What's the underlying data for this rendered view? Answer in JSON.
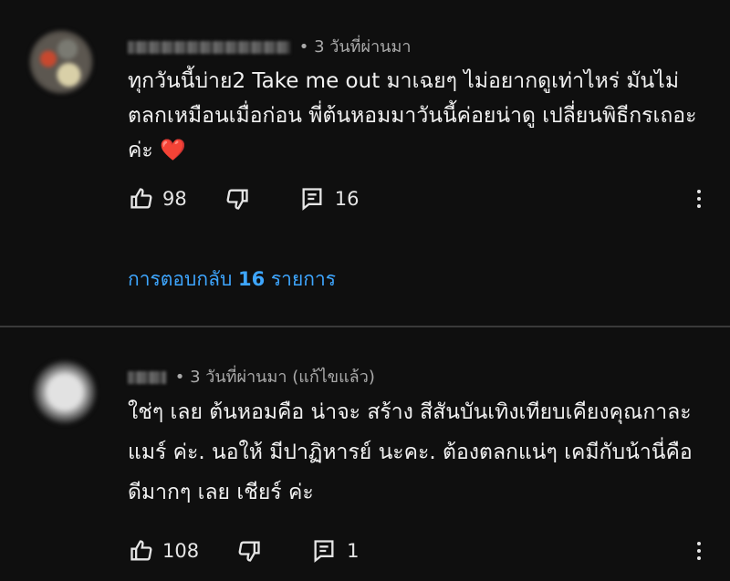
{
  "comments": [
    {
      "time": "3 วันที่ผ่านมา",
      "edited": "",
      "text": "ทุกวันนี้บ่าย2 Take me out มาเฉยๆ ไม่อยากดูเท่าไหร่ มันไม่ตลกเหมือนเมื่อก่อน พี่ต้นหอมมาวันนี้ค่อยน่าดู เปลี่ยนพิธีกรเถอะค่ะ",
      "emoji": "❤️",
      "likes": "98",
      "replies": "16",
      "replies_link": {
        "prefix": "การตอบกลับ ",
        "count": "16",
        "suffix": " รายการ"
      }
    },
    {
      "time": "3 วันที่ผ่านมา",
      "edited": "(แก้ไขแล้ว)",
      "text": "ใช่ๆ เลย ต้นหอมคือ น่าจะ สร้าง สีสันบันเทิงเทียบเคียงคุณกาละแมร์ ค่ะ. นอให้ มีปาฏิหารย์ นะคะ. ต้องตลกแน่ๆ เคมีกับน้านี่คือ ดีมากๆ เลย เชียร์ ค่ะ",
      "likes": "108",
      "replies": "1"
    }
  ],
  "colors": {
    "background": "#0f0f0f",
    "link": "#3ea6ff",
    "meta": "#aaaaaa"
  },
  "icons": [
    "thumbs-up-icon",
    "thumbs-down-icon",
    "reply-icon",
    "more-vert-icon"
  ]
}
